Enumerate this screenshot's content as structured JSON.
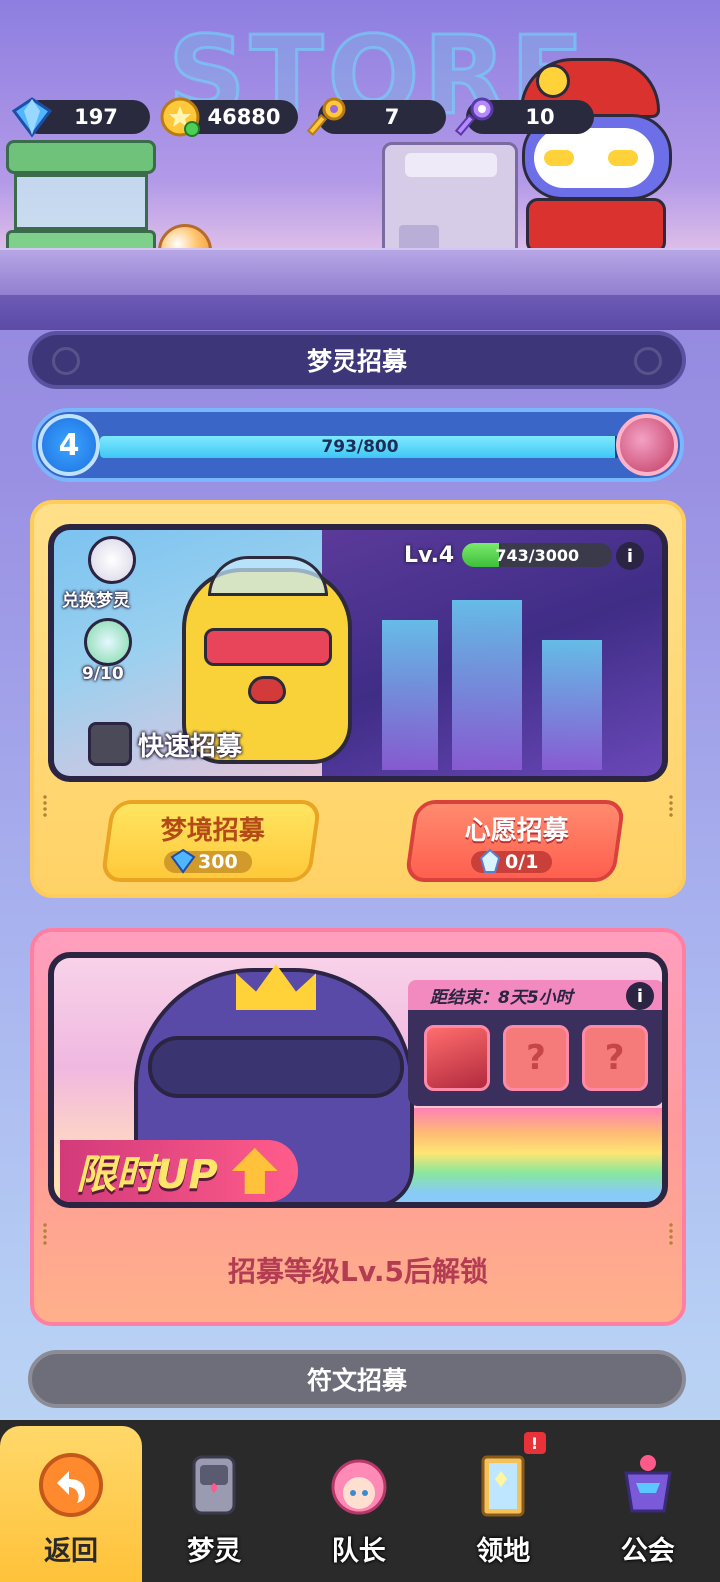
{
  "header": {
    "store_title": "STORE",
    "currencies": [
      {
        "icon": "diamond-icon",
        "value": "197"
      },
      {
        "icon": "gold-coin-icon",
        "value": "46880"
      },
      {
        "icon": "gold-key-icon",
        "value": "7"
      },
      {
        "icon": "purple-key-icon",
        "value": "10"
      }
    ]
  },
  "dream_recruit": {
    "title": "梦灵招募",
    "level": "4",
    "progress_text": "793/800",
    "progress_ratio": 0.99125
  },
  "card_normal": {
    "exchange_label": "兑换梦灵",
    "crystal_count": "9/10",
    "quick_recruit_label": "快速招募",
    "lv_label": "Lv.4",
    "lv_progress_text": "743/3000",
    "lv_progress_ratio": 0.2477,
    "info_glyph": "i",
    "dream_button": {
      "label": "梦境招募",
      "cost": "300"
    },
    "wish_button": {
      "label": "心愿招募",
      "cost": "0/1"
    }
  },
  "card_limited": {
    "countdown": "距结束：8天5小时",
    "info_glyph": "i",
    "tag_label": "限时UP",
    "unknown_glyph": "?",
    "lock_text": "招募等级Lv.5后解锁"
  },
  "rune_recruit": {
    "title": "符文招募"
  },
  "bottom_nav": {
    "items": [
      {
        "label": "返回",
        "active": true
      },
      {
        "label": "梦灵",
        "active": false
      },
      {
        "label": "队长",
        "active": false
      },
      {
        "label": "领地",
        "active": false,
        "badge": "!"
      },
      {
        "label": "公会",
        "active": false
      }
    ]
  },
  "colors": {
    "accent_yellow": "#ffd266",
    "accent_pink": "#ff9fbf",
    "progress_blue": "#3fc7f4",
    "nav_bg": "#2a2a2a"
  }
}
